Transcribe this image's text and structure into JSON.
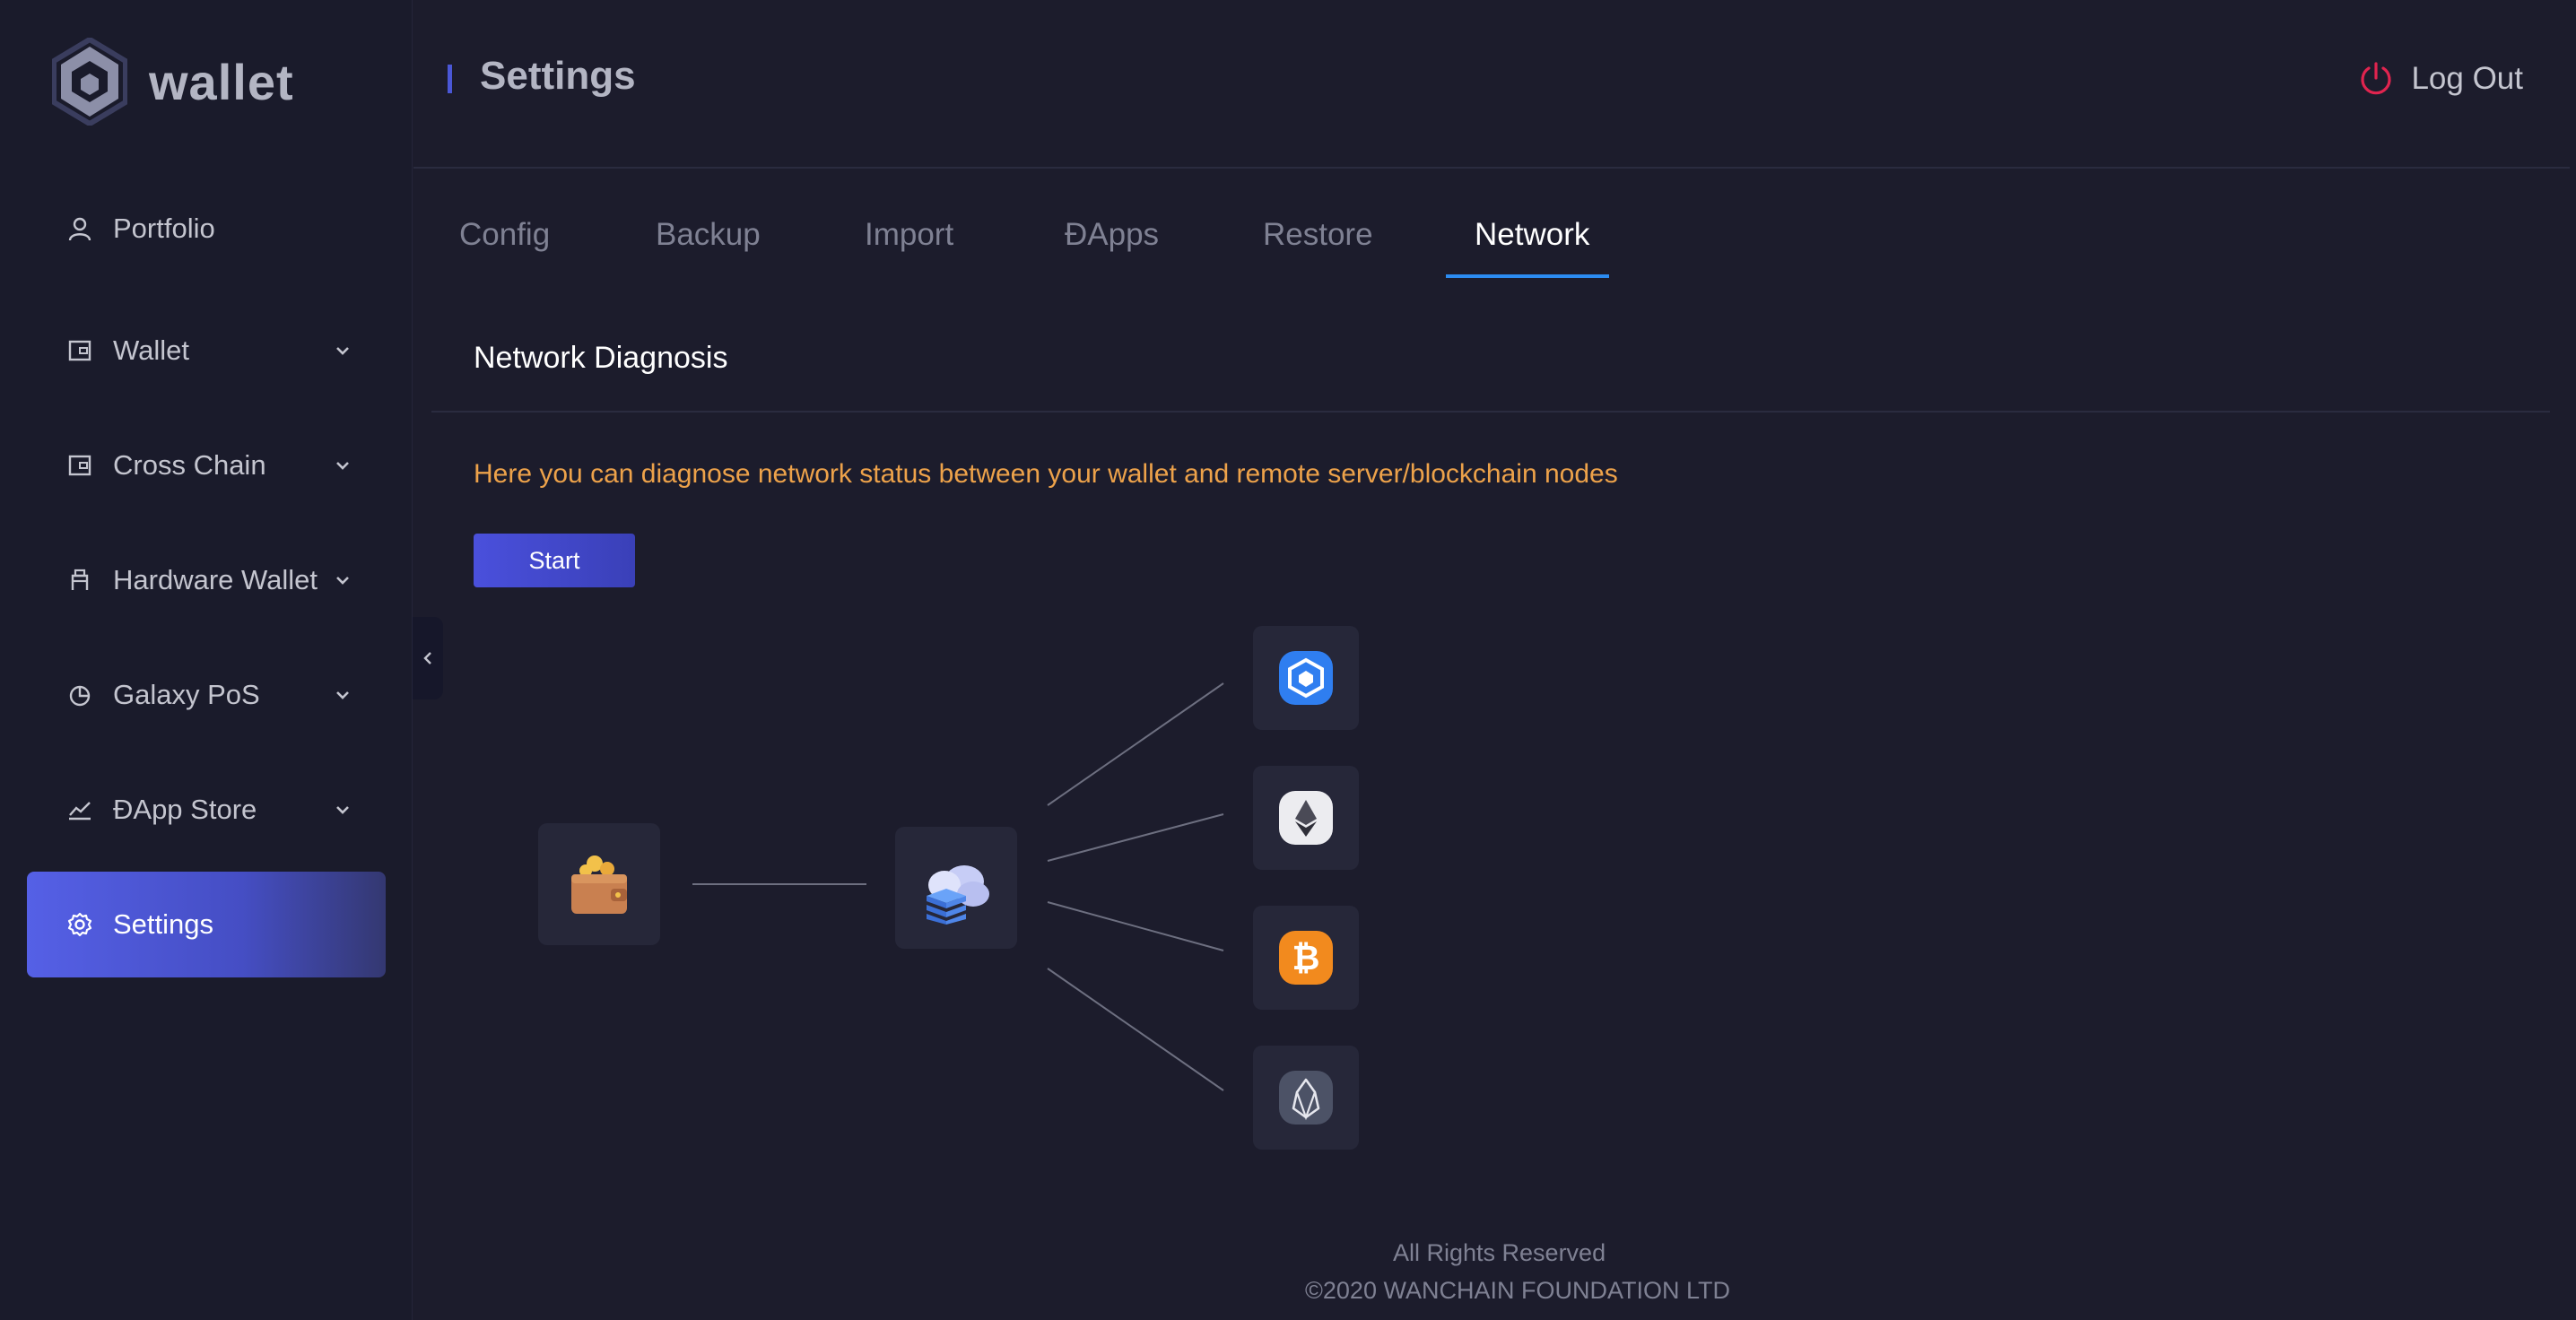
{
  "app": {
    "logo_text": "wallet"
  },
  "sidebar": {
    "items": [
      {
        "label": "Portfolio"
      },
      {
        "label": "Wallet"
      },
      {
        "label": "Cross Chain"
      },
      {
        "label": "Hardware Wallet"
      },
      {
        "label": "Galaxy PoS"
      },
      {
        "label": "ĐApp Store"
      },
      {
        "label": "Settings"
      }
    ],
    "active": "Settings"
  },
  "header": {
    "title": "Settings",
    "logout_label": "Log Out"
  },
  "tabs": [
    {
      "label": "Config"
    },
    {
      "label": "Backup"
    },
    {
      "label": "Import"
    },
    {
      "label": "ĐApps"
    },
    {
      "label": "Restore"
    },
    {
      "label": "Network"
    }
  ],
  "active_tab": "Network",
  "network": {
    "section_title": "Network Diagnosis",
    "description": "Here you can diagnose network status between your wallet and remote server/blockchain nodes",
    "start_label": "Start",
    "nodes": [
      "wallet-icon",
      "server-cloud-icon",
      "wanchain-icon",
      "ethereum-icon",
      "bitcoin-icon",
      "eos-icon"
    ]
  },
  "footer": {
    "line1": "All Rights Reserved",
    "line2": "©2020 WANCHAIN FOUNDATION LTD"
  },
  "colors": {
    "background": "#1c1c2c",
    "accent": "#5560e6",
    "tab_underline": "#2c8cf2",
    "description": "#eda24a",
    "logout_icon": "#e0244f"
  }
}
